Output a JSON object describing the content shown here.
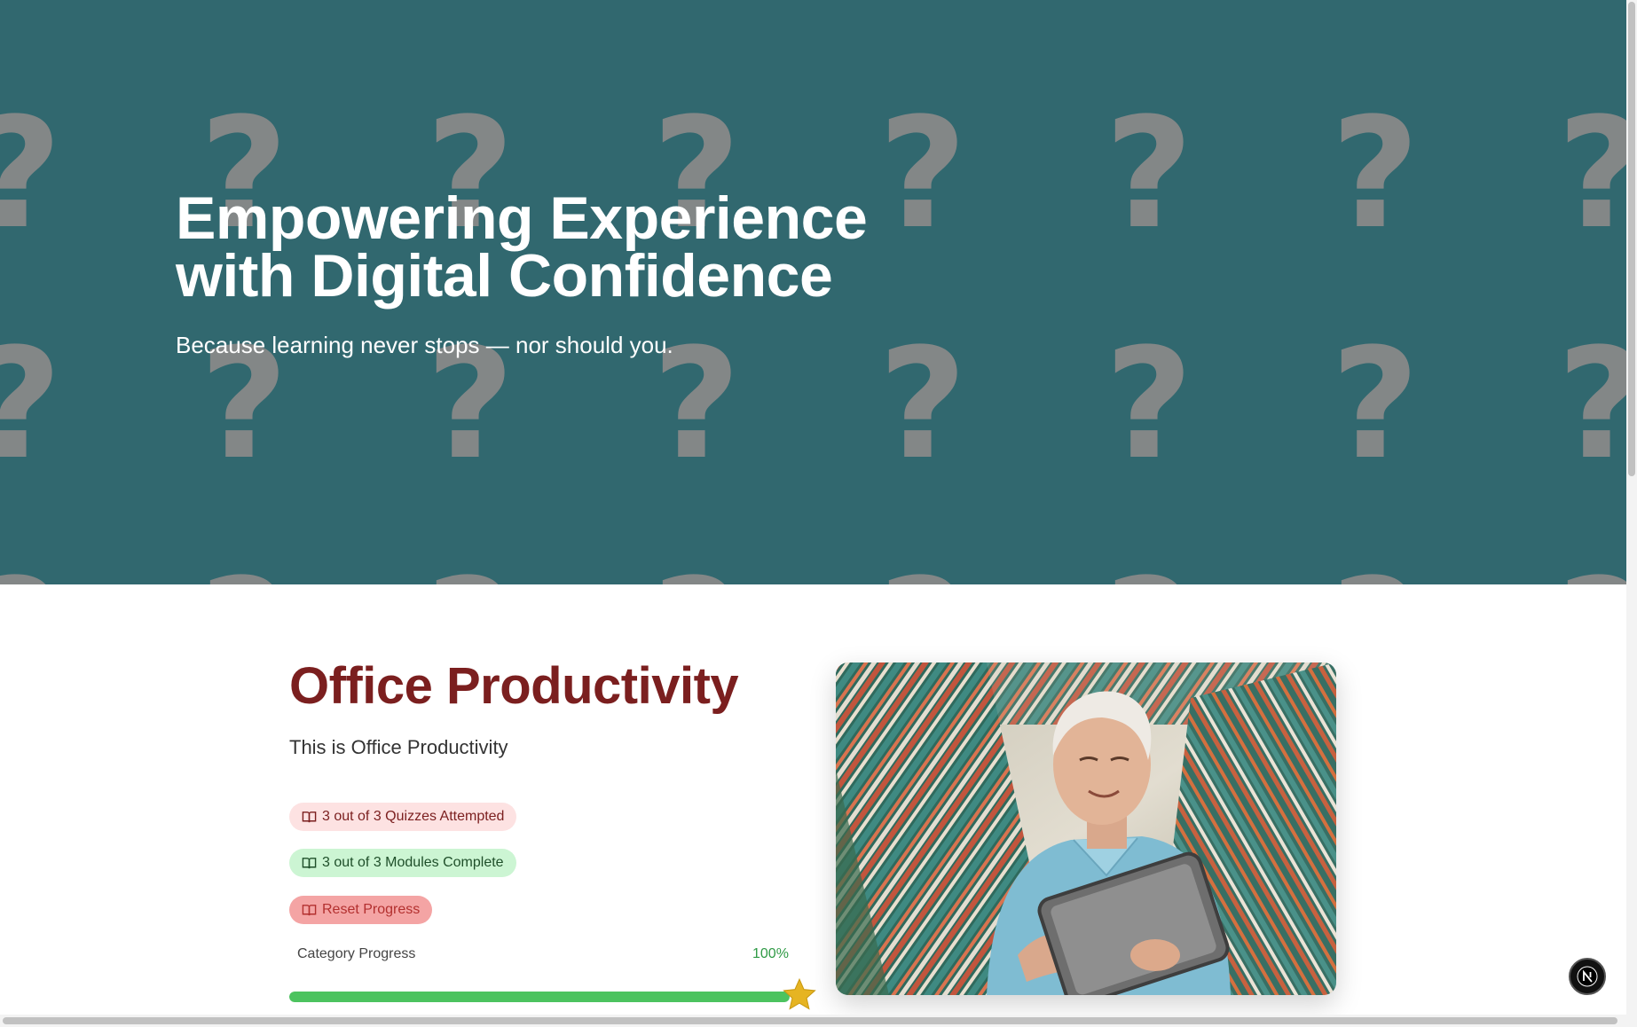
{
  "hero": {
    "title": "Empowering Experience with Digital Confidence",
    "subtitle": "Because learning never stops — nor should you.",
    "pattern_glyph": "?",
    "background_color": "#31686f"
  },
  "category": {
    "title": "Office Productivity",
    "description": "This is Office Productivity",
    "quizzes_label": "3 out of 3 Quizzes Attempted",
    "modules_label": "3 out of 3 Modules Complete",
    "reset_label": "Reset Progress",
    "progress_label": "Category Progress",
    "progress_text": "100%",
    "progress_value": 100,
    "title_color": "#7b1f1f",
    "progress_color": "#4cc35f"
  },
  "icons": {
    "pill": "book-open-icon",
    "progress_end": "star-icon",
    "fab": "next-logo-icon"
  },
  "fab": {
    "letter": "N"
  }
}
